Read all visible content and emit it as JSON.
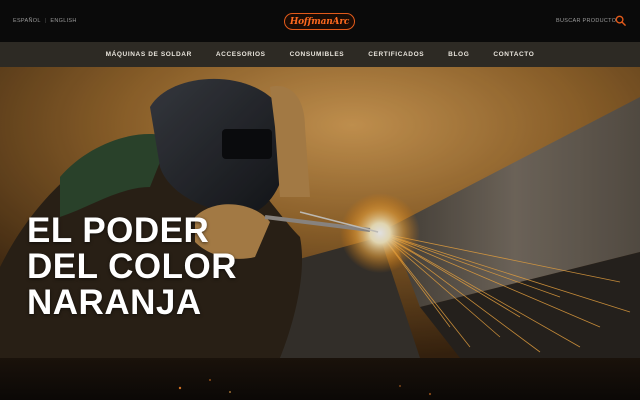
{
  "header": {
    "languages": [
      "ESPAÑOL",
      "ENGLISH"
    ],
    "language_separator": "|",
    "logo_text": "HoffmanArc",
    "search_label": "BUSCAR PRODUCTO"
  },
  "nav": {
    "items": [
      "MÁQUINAS DE SOLDAR",
      "ACCESORIOS",
      "CONSUMIBLES",
      "CERTIFICADOS",
      "BLOG",
      "CONTACTO"
    ]
  },
  "hero": {
    "headline": [
      "EL PODER",
      "DEL COLOR",
      "NARANJA"
    ]
  },
  "colors": {
    "brand_orange": "#e35a1a",
    "nav_background": "#2d2a24",
    "header_background": "#0a0a0a"
  },
  "icons": {
    "search": "search-icon",
    "logo": "hoffmanarc-logo"
  }
}
